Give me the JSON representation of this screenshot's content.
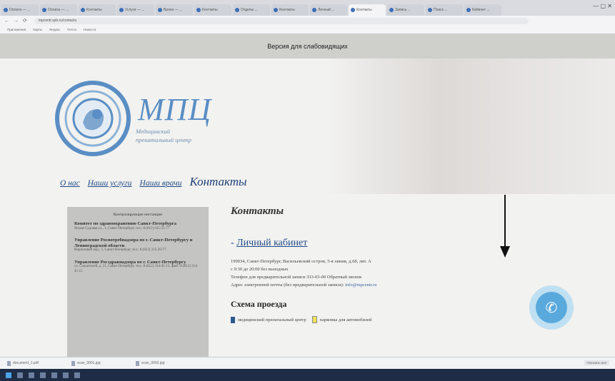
{
  "browser": {
    "tabs": [
      {
        "title": "Оплата — ...",
        "active": false
      },
      {
        "title": "Оплата — ...",
        "active": false
      },
      {
        "title": "Контакты",
        "active": false
      },
      {
        "title": "Услуги — ...",
        "active": false
      },
      {
        "title": "Врачи — ...",
        "active": false
      },
      {
        "title": "Контакты",
        "active": false
      },
      {
        "title": "Отделы ...",
        "active": false
      },
      {
        "title": "Контакты",
        "active": false
      },
      {
        "title": "Личный ...",
        "active": false
      },
      {
        "title": "Контакты",
        "active": true
      },
      {
        "title": "Запись ...",
        "active": false
      },
      {
        "title": "Поиск ...",
        "active": false
      },
      {
        "title": "Кабинет ...",
        "active": false
      }
    ],
    "window_controls": "— ▢ ✕",
    "back": "←",
    "forward": "→",
    "reload": "⟳",
    "url": "mpcentr.spb.ru/contacts",
    "bookmarks": [
      "Приложения",
      "Карты",
      "Яндекс",
      "Почта",
      "Новости"
    ]
  },
  "site": {
    "accessibility_label": "Версия для слабовидящих",
    "logo_text": "МПЦ",
    "logo_subtitle_line1": "Медицинский",
    "logo_subtitle_line2": "пренатальный центр",
    "menu": [
      {
        "label": "О нас",
        "current": false
      },
      {
        "label": "Наши услуги",
        "current": false
      },
      {
        "label": "Наши врачи",
        "current": false
      },
      {
        "label": "Контакты",
        "current": true
      }
    ]
  },
  "sidebar": {
    "heading": "Контролирующие инстанции",
    "blocks": [
      {
        "title": "Комитет по здравоохранению Санкт-Петербурга",
        "text": "Малая Садовая ул., 1, Санкт-Петербург, тел.: 8 (812) 635-55-77"
      },
      {
        "title": "Управление Роспотребнадзора по г. Санкт-Петербургу и Ленинградской области",
        "text": "Кирпичный пер., 5, Санкт-Петербург, тел.: 8 (812) 315-29-77"
      },
      {
        "title": "Управление Росздравнадзора по г. Санкт-Петербургу",
        "text": "ул. Строителей, д. 21, Санкт-Петербург, тел.: 8 (812) 314-45-15, факс: 8 (812) 314-45-15"
      }
    ]
  },
  "main": {
    "page_title": "Контакты",
    "cabinet_prefix": "- ",
    "cabinet_link": "Личный кабинет",
    "address": "199034, Санкт-Петербург, Васильевский остров, 5-я линия, д.68, лит. А",
    "hours": "с 9:30 до 20:00 без выходных",
    "phone_text": "Телефон для предварительной записи 333-03-00 Обратный звонок",
    "email_text": "Адрес электронной почты (без предварительной записи):",
    "email": "info@mpcentr.ru",
    "scheme_title": "Схема проезда",
    "legend_center": "медицинский пренатальный центр",
    "legend_parking": "парковка для автомобилей"
  },
  "call_button": {
    "icon": "phone-icon"
  },
  "downloads": {
    "items": [
      "document_1.pdf",
      "scan_0001.jpg",
      "scan_0002.jpg"
    ],
    "show_all": "Показать всё"
  },
  "colors": {
    "accent_blue": "#5a8ec4",
    "link_blue": "#1f4a86",
    "call_button": "#5aa9dc",
    "accessibility_bar": "#cfcfcc",
    "sidebar_bg": "#c4c4c2"
  }
}
